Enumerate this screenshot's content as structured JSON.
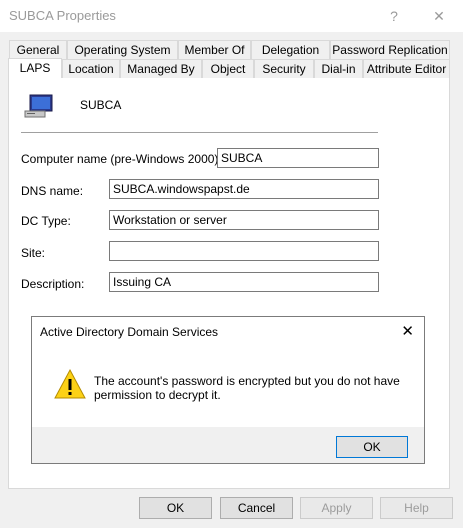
{
  "window": {
    "title": "SUBCA Properties",
    "help_glyph": "?",
    "close_glyph": "✕"
  },
  "tabs": {
    "row1": [
      "General",
      "Operating System",
      "Member Of",
      "Delegation",
      "Password Replication"
    ],
    "row2": [
      "LAPS",
      "Location",
      "Managed By",
      "Object",
      "Security",
      "Dial-in",
      "Attribute Editor"
    ],
    "active": "LAPS"
  },
  "object": {
    "name": "SUBCA",
    "icon": "computer-icon"
  },
  "fields": {
    "computer_name_label": "Computer name (pre-Windows 2000):",
    "computer_name_value": "SUBCA",
    "dns_label": "DNS name:",
    "dns_value": "SUBCA.windowspapst.de",
    "dc_type_label": "DC Type:",
    "dc_type_value": "Workstation or server",
    "site_label": "Site:",
    "site_value": "",
    "description_label": "Description:",
    "description_value": "Issuing CA"
  },
  "dialog": {
    "title": "Active Directory Domain Services",
    "message": "The account's password is encrypted but you do not have permission to decrypt it.",
    "ok_label": "OK",
    "close_glyph": "✕",
    "icon": "warning-icon"
  },
  "buttons": {
    "ok": "OK",
    "cancel": "Cancel",
    "apply": "Apply",
    "help": "Help"
  },
  "colors": {
    "accent": "#0078d7",
    "warning": "#fcd116"
  }
}
